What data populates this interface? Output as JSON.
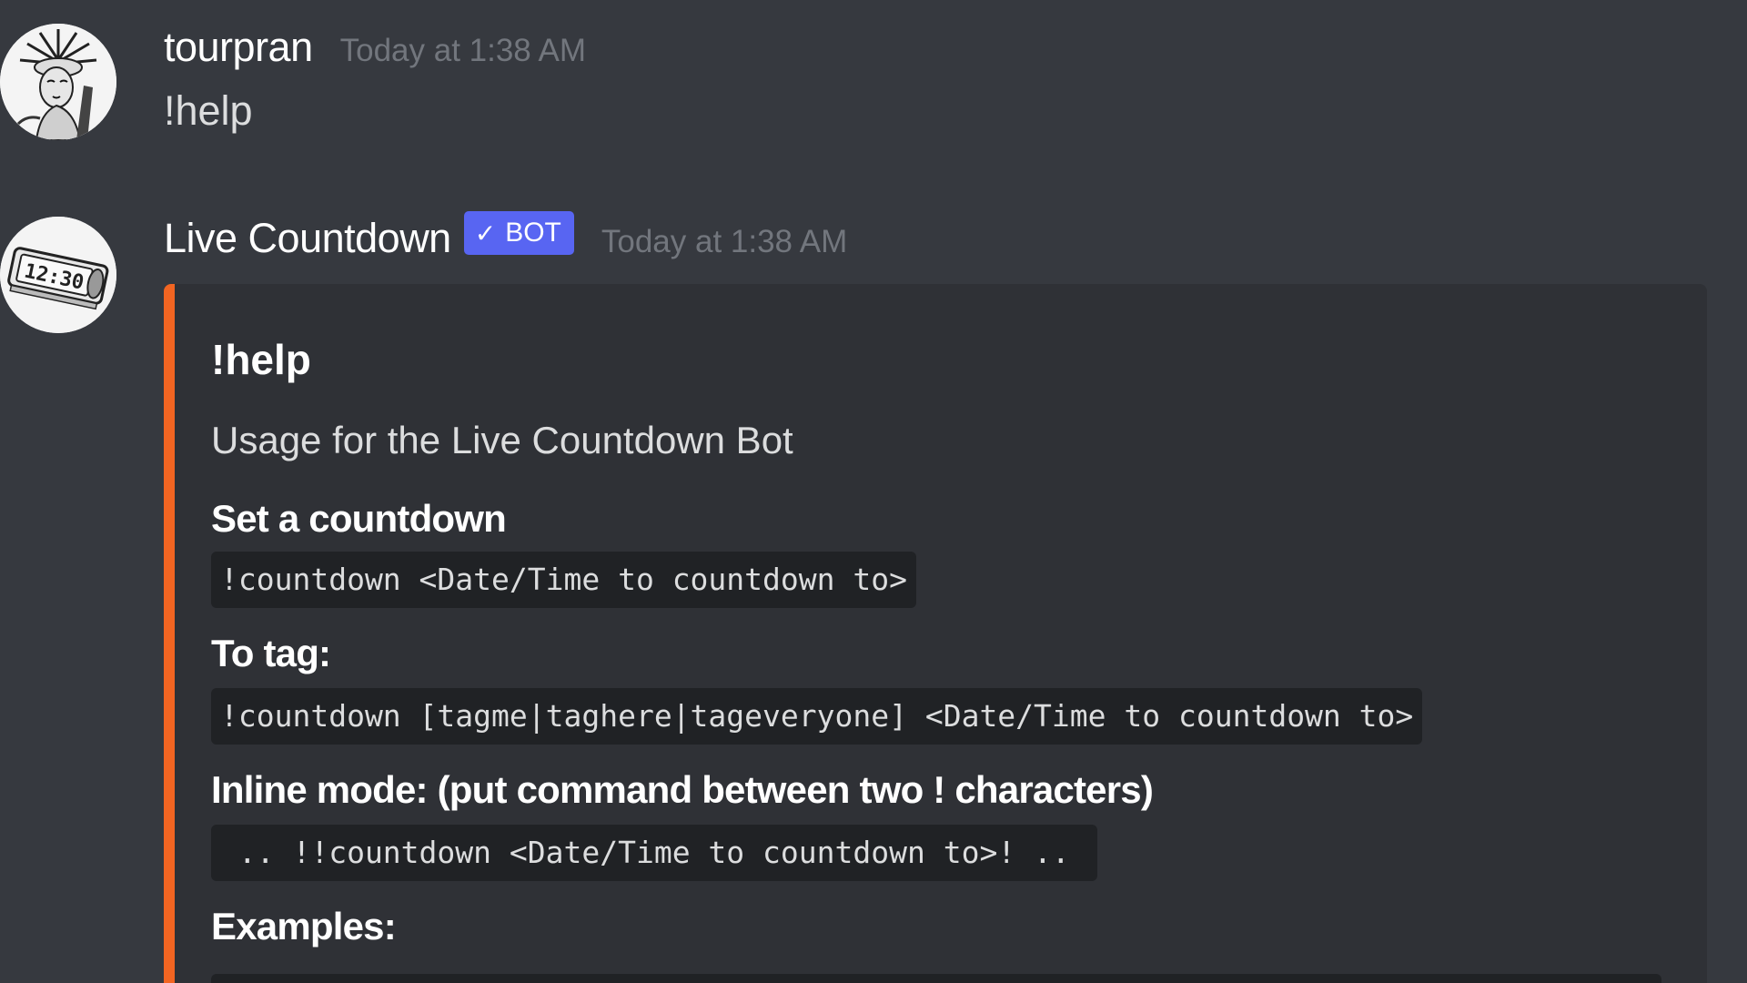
{
  "messages": [
    {
      "username": "tourpran",
      "timestamp": "Today at 1:38 AM",
      "content": "!help",
      "avatar_icon": "statue-of-liberty-avatar"
    },
    {
      "username": "Live Countdown",
      "badge": "BOT",
      "badge_check": "✓",
      "timestamp": "Today at 1:38 AM",
      "avatar_icon": "clock-avatar",
      "embed": {
        "accent_color": "#f26522",
        "title": "!help",
        "description": "Usage for the Live Countdown Bot",
        "fields": [
          {
            "name": "Set a countdown",
            "value": "!countdown <Date/Time to countdown to>"
          },
          {
            "name": "To tag:",
            "value": "!countdown [tagme|taghere|tageveryone] <Date/Time to countdown to>"
          },
          {
            "name": "Inline mode: (put command between two ! characters)",
            "value": " .. !!countdown <Date/Time to countdown to>! .. "
          },
          {
            "name": "Examples:",
            "value": ""
          }
        ]
      }
    }
  ],
  "colors": {
    "background": "#36393f",
    "embed_background": "#2f3136",
    "code_background": "#202225",
    "bot_badge": "#5865f2",
    "timestamp": "#72767d"
  }
}
